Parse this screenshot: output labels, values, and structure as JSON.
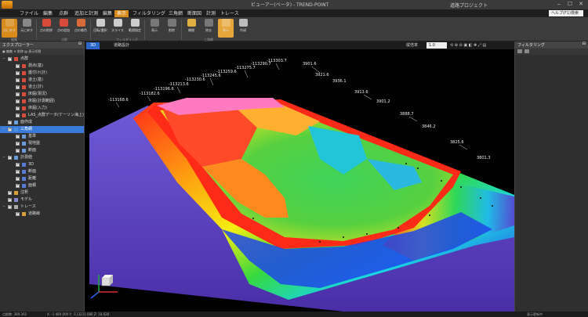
{
  "titlebar": {
    "title": "ビューアー(ベータ) - TREND-POINT",
    "project": "道路プロジェクト"
  },
  "menu": {
    "tabs": [
      "ファイル",
      "編集",
      "点群",
      "追加と計測",
      "編集",
      "表示",
      "フィルタリング",
      "三角網",
      "断面図",
      "計測",
      "トレース"
    ],
    "active_tab": 5,
    "help_placeholder": "ヘルプ(F1)検索"
  },
  "ribbon": {
    "buttons": [
      {
        "label": "点に戻す",
        "color": "#e08a1c",
        "highlight": true
      },
      {
        "label": "元に戻す",
        "color": "#bbbbbb"
      },
      {
        "label": "点の削除",
        "color": "#d84a3a"
      },
      {
        "label": "点の追加",
        "color": "#d84a3a"
      },
      {
        "label": "点の着色",
        "color": "#d86a3a"
      },
      {
        "label": "回転/選択",
        "color": "#cccccc"
      },
      {
        "label": "スライス",
        "color": "#cccccc"
      },
      {
        "label": "範囲指定",
        "color": "#cccccc"
      },
      {
        "label": "表示",
        "color": "#cccccc"
      },
      {
        "label": "削除",
        "color": "#cccccc"
      },
      {
        "label": "補間",
        "color": "#e0b040"
      },
      {
        "label": "除去",
        "color": "#cccccc"
      },
      {
        "label": "表示",
        "color": "#e08a1c",
        "highlight": true
      },
      {
        "label": "作成",
        "color": "#bbbbbb"
      }
    ],
    "groups": [
      "編集",
      "点群",
      "フィルタリング",
      "三角網"
    ]
  },
  "left_panel": {
    "title": "エクスプローラー",
    "tools": "▣ 編集  ✕ 削除  ▤ 表示切替",
    "tree": [
      {
        "label": "点群",
        "level": 0,
        "icon": "#d84a3a",
        "expand": "−"
      },
      {
        "label": "測点(基)",
        "level": 1,
        "icon": "#d84a3a"
      },
      {
        "label": "盛付け(計)",
        "level": 1,
        "icon": "#d84a3a"
      },
      {
        "label": "道土(基)",
        "level": 1,
        "icon": "#d84a3a"
      },
      {
        "label": "道土(計)",
        "level": 1,
        "icon": "#d84a3a"
      },
      {
        "label": "床掘(現況)",
        "level": 1,
        "icon": "#d84a3a"
      },
      {
        "label": "床掘(計測範囲)",
        "level": 1,
        "icon": "#d84a3a"
      },
      {
        "label": "床掘(入力)",
        "level": 1,
        "icon": "#d84a3a"
      },
      {
        "label": "LAS_点群データ(ケーソン海上)",
        "level": 1,
        "icon": "#d84a3a"
      },
      {
        "label": "面作成",
        "level": 0,
        "icon": "#6aa0e0"
      },
      {
        "label": "三角網",
        "level": 0,
        "icon": "#4a90e2",
        "selected": true,
        "expand": "−"
      },
      {
        "label": "基準",
        "level": 1,
        "icon": "#6a9ad8"
      },
      {
        "label": "現地盤",
        "level": 1,
        "icon": "#6a9ad8"
      },
      {
        "label": "断面",
        "level": 1,
        "icon": "#6a9ad8"
      },
      {
        "label": "計測値",
        "level": 0,
        "icon": "#6a9ad8",
        "expand": "−"
      },
      {
        "label": "3D",
        "level": 1,
        "icon": "#5a7ad8"
      },
      {
        "label": "断面",
        "level": 1,
        "icon": "#5a7ad8"
      },
      {
        "label": "距離",
        "level": 1,
        "icon": "#5a7ad8"
      },
      {
        "label": "面積",
        "level": 1,
        "icon": "#5a7ad8"
      },
      {
        "label": "注釈",
        "level": 0,
        "icon": "#d8a03a"
      },
      {
        "label": "モデル",
        "level": 0,
        "icon": "#8888cc"
      },
      {
        "label": "トレース",
        "level": 0,
        "icon": "#aaaaaa",
        "expand": "−"
      },
      {
        "label": "道路線",
        "level": 1,
        "icon": "#d8a03a"
      }
    ]
  },
  "right_panel": {
    "title": "フィルタリング"
  },
  "viewport": {
    "tabs": [
      "3D",
      "道路設計"
    ],
    "active_tab": 0,
    "scale_label": "縦倍率",
    "scale_value": "1.0",
    "labels_left": [
      "-113168.6",
      "-113182.6",
      "-113196.6",
      "-113213.6",
      "-113230.6",
      "-113245.6",
      "-113259.6",
      "-113275.7",
      "-113290.7",
      "-113303.7"
    ],
    "labels_right": [
      "3901.6",
      "3921.6",
      "3936.1",
      "3913.6",
      "3901.2",
      "3888.7",
      "3846.2",
      "3825.6",
      "3801.3"
    ]
  },
  "statusbar": {
    "left": "点群数: 389.361",
    "coords": "X: -1 480.000  Y: -113231.086  Z: 18.628",
    "right": "表示更新中"
  }
}
